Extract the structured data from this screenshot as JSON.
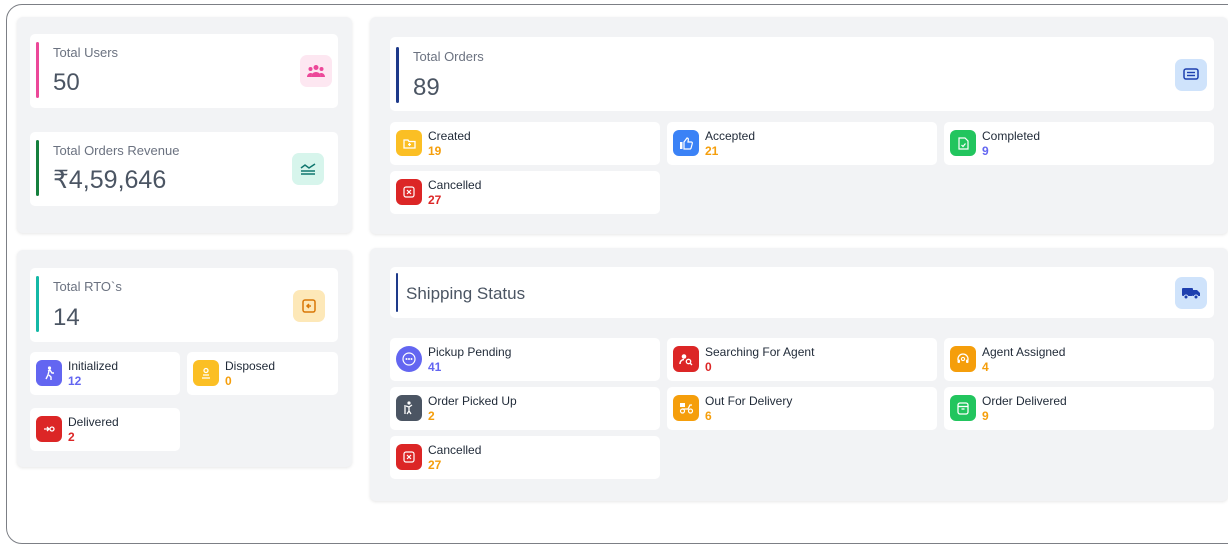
{
  "total_users": {
    "label": "Total Users",
    "value": "50"
  },
  "total_revenue": {
    "label": "Total Orders Revenue",
    "value": "₹4,59,646"
  },
  "total_rtos": {
    "label": "Total RTO`s",
    "value": "14",
    "items": [
      {
        "label": "Initialized",
        "value": "12"
      },
      {
        "label": "Disposed",
        "value": "0"
      },
      {
        "label": "Delivered",
        "value": "2"
      }
    ]
  },
  "total_orders": {
    "label": "Total Orders",
    "value": "89",
    "items": [
      {
        "label": "Created",
        "value": "19"
      },
      {
        "label": "Accepted",
        "value": "21"
      },
      {
        "label": "Completed",
        "value": "9"
      },
      {
        "label": "Cancelled",
        "value": "27"
      }
    ]
  },
  "shipping_status": {
    "title": "Shipping Status",
    "items": [
      {
        "label": "Pickup Pending",
        "value": "41"
      },
      {
        "label": "Searching For Agent",
        "value": "0"
      },
      {
        "label": "Agent Assigned",
        "value": "4"
      },
      {
        "label": "Order Picked Up",
        "value": "2"
      },
      {
        "label": "Out For Delivery",
        "value": "6"
      },
      {
        "label": "Order Delivered",
        "value": "9"
      },
      {
        "label": "Cancelled",
        "value": "27"
      }
    ]
  },
  "colors": {
    "pink": "#ec4899",
    "green": "#15803d",
    "teal": "#14b8a6",
    "navy": "#1e3a8a",
    "orange": "#f59e0b",
    "red": "#dc2626",
    "blue": "#2563eb",
    "purple": "#6366f1"
  }
}
